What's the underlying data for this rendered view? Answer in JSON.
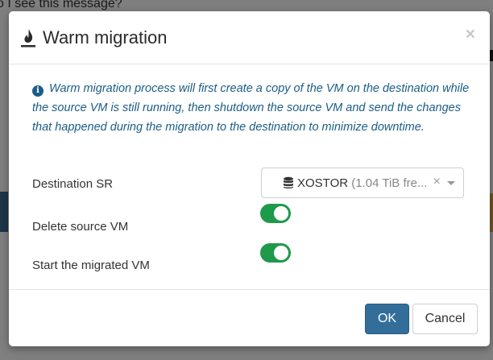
{
  "background": {
    "question_text": "o I see this message?"
  },
  "modal": {
    "title": "Warm migration",
    "close_symbol": "×",
    "info_text": "Warm migration process will first create a copy of the VM on the destination while the source VM is still running, then shutdown the source VM and send the changes that happened during the migration to the destination to minimize downtime.",
    "fields": {
      "destination_sr_label": "Destination SR",
      "destination_sr_name": "XOSTOR",
      "destination_sr_detail": "(1.04 TiB fre...",
      "destination_sr_clear": "×",
      "delete_source_label": "Delete source VM",
      "delete_source_enabled": true,
      "start_migrated_label": "Start the migrated VM",
      "start_migrated_enabled": true
    },
    "buttons": {
      "ok_label": "OK",
      "cancel_label": "Cancel"
    }
  },
  "colors": {
    "info": "#1b5d86",
    "toggle_on": "#1e9a4a",
    "primary": "#336e9b"
  },
  "icons": {
    "title": "fire-icon",
    "info": "info-circle-icon",
    "sr": "database-icon"
  }
}
